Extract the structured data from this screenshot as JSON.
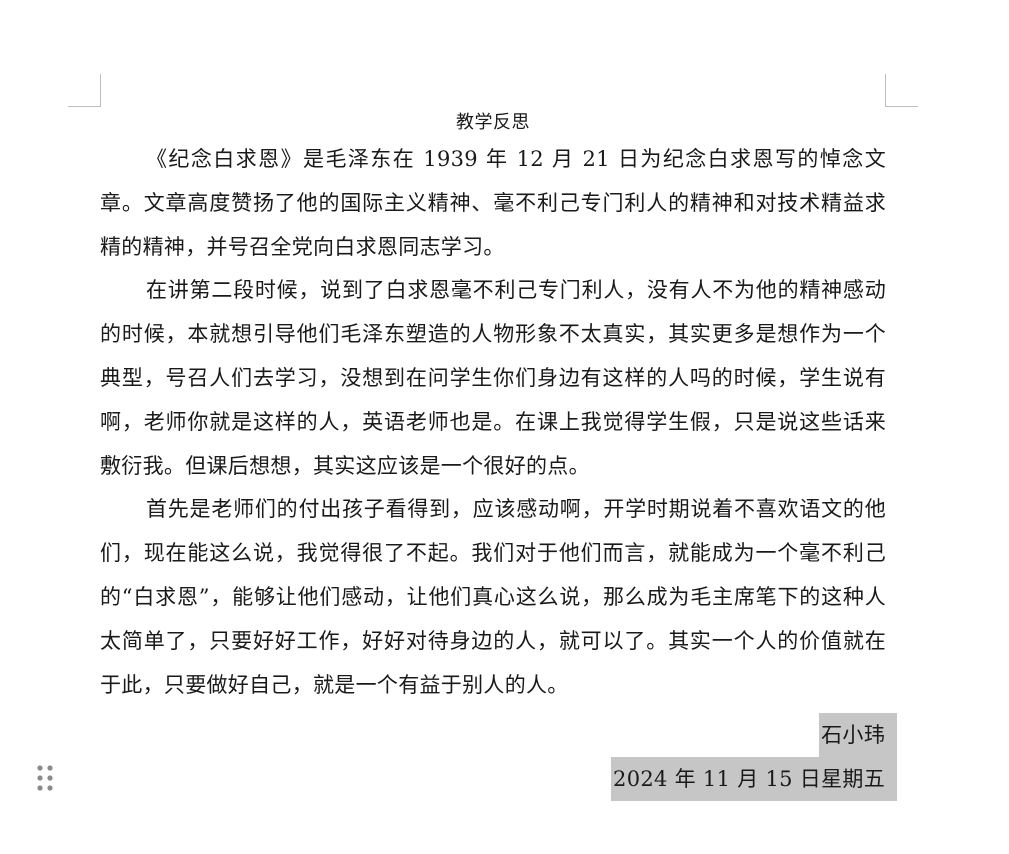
{
  "document": {
    "title": "教学反思",
    "paragraphs": [
      "《纪念白求恩》是毛泽东在 1939 年 12 月 21 日为纪念白求恩写的悼念文章。文章高度赞扬了他的国际主义精神、毫不利己专门利人的精神和对技术精益求精的精神，并号召全党向白求恩同志学习。",
      "在讲第二段时候，说到了白求恩毫不利己专门利人，没有人不为他的精神感动的时候，本就想引导他们毛泽东塑造的人物形象不太真实，其实更多是想作为一个典型，号召人们去学习，没想到在问学生你们身边有这样的人吗的时候，学生说有啊，老师你就是这样的人，英语老师也是。在课上我觉得学生假，只是说这些话来敷衍我。但课后想想，其实这应该是一个很好的点。",
      "首先是老师们的付出孩子看得到，应该感动啊，开学时期说着不喜欢语文的他们，现在能这么说，我觉得很了不起。我们对于他们而言，就能成为一个毫不利己的“白求恩”，能够让他们感动，让他们真心这么说，那么成为毛主席笔下的这种人太简单了，只要好好工作，好好对待身边的人，就可以了。其实一个人的价值就在于此，只要做好自己，就是一个有益于别人的人。"
    ],
    "signature": {
      "author": "石小玮",
      "date": "2024 年 11 月 15 日星期五"
    }
  },
  "icons": {
    "drag_handle": "drag-handle-icon"
  },
  "colors": {
    "selection_highlight": "#c6c6c6",
    "text": "#1a1a1a"
  }
}
